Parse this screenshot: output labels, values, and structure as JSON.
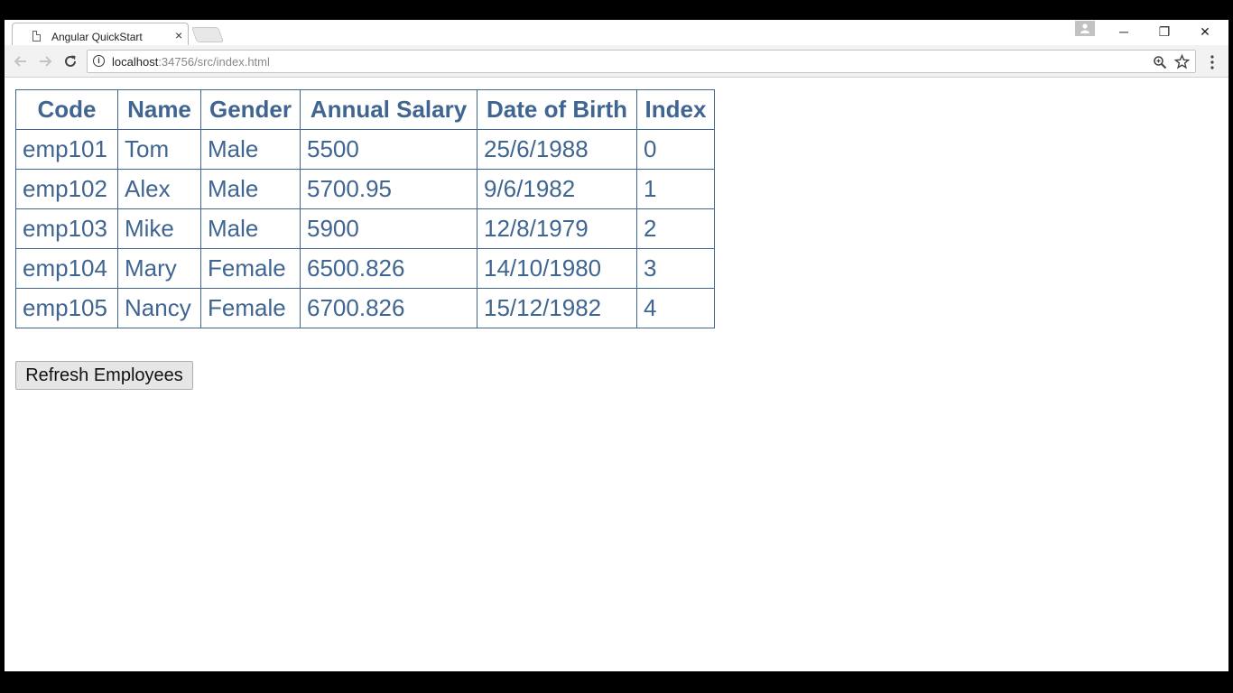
{
  "browser": {
    "tab_title": "Angular QuickStart",
    "tab_close": "×",
    "url_host": "localhost",
    "url_path": ":34756/src/index.html",
    "window_controls": {
      "minimize": "─",
      "restore": "❐",
      "close": "✕"
    }
  },
  "table": {
    "headers": [
      "Code",
      "Name",
      "Gender",
      "Annual Salary",
      "Date of Birth",
      "Index"
    ],
    "rows": [
      [
        "emp101",
        "Tom",
        "Male",
        "5500",
        "25/6/1988",
        "0"
      ],
      [
        "emp102",
        "Alex",
        "Male",
        "5700.95",
        "9/6/1982",
        "1"
      ],
      [
        "emp103",
        "Mike",
        "Male",
        "5900",
        "12/8/1979",
        "2"
      ],
      [
        "emp104",
        "Mary",
        "Female",
        "6500.826",
        "14/10/1980",
        "3"
      ],
      [
        "emp105",
        "Nancy",
        "Female",
        "6700.826",
        "15/12/1982",
        "4"
      ]
    ]
  },
  "actions": {
    "refresh_label": "Refresh Employees"
  },
  "colors": {
    "table_text": "#3f6590",
    "table_border": "#3f6590"
  }
}
